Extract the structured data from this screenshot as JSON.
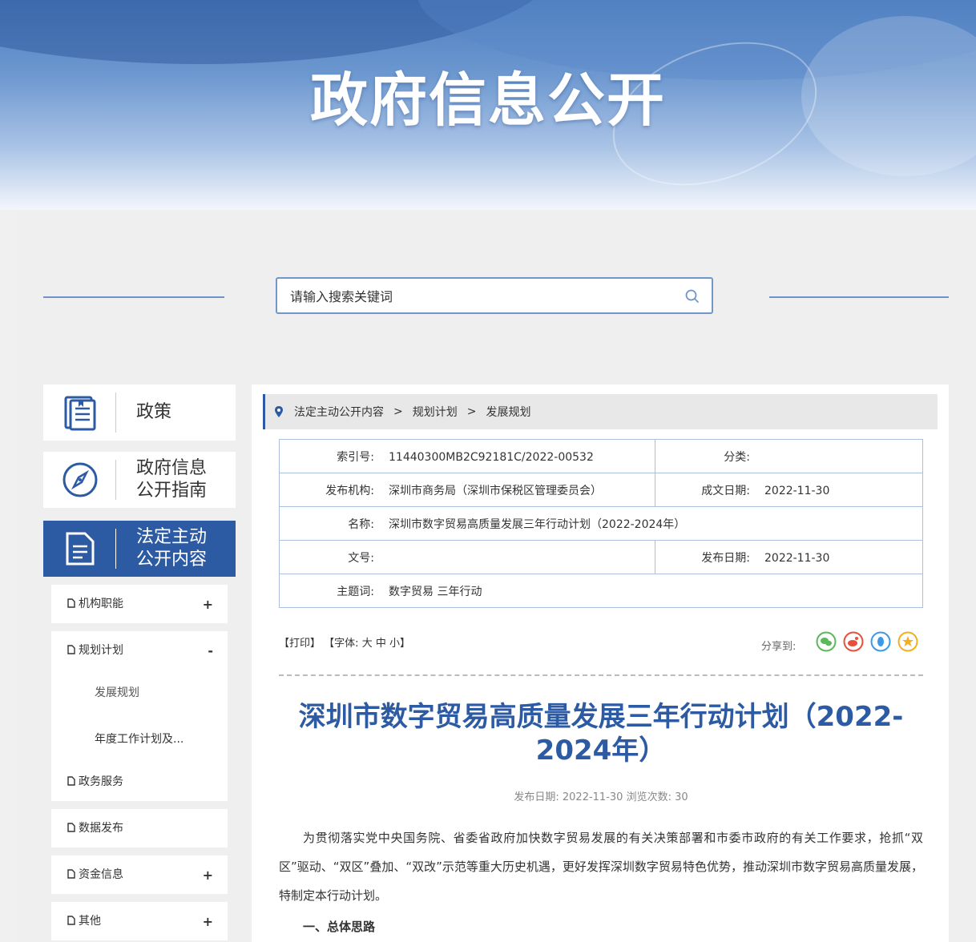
{
  "banner": {
    "title": "政府信息公开"
  },
  "search": {
    "placeholder": "请输入搜索关键词"
  },
  "nav": {
    "main": [
      {
        "label": "政策"
      },
      {
        "label": "政府信息\n公开指南"
      },
      {
        "label": "法定主动\n公开内容"
      }
    ],
    "sub": [
      {
        "label": "机构职能",
        "toggle": "+"
      },
      {
        "label": "规划计划",
        "toggle": "-",
        "children": [
          "发展规划",
          "年度工作计划及..."
        ]
      },
      {
        "label": "政务服务",
        "toggle": ""
      },
      {
        "label": "数据发布",
        "toggle": ""
      },
      {
        "label": "资金信息",
        "toggle": "+"
      },
      {
        "label": "其他",
        "toggle": "+"
      }
    ]
  },
  "breadcrumb": {
    "items": [
      "法定主动公开内容",
      "规划计划",
      "发展规划"
    ],
    "sep": ">"
  },
  "meta": {
    "index_label": "索引号:",
    "index_value": "11440300MB2C92181C/2022-00532",
    "category_label": "分类:",
    "category_value": "",
    "org_label": "发布机构:",
    "org_value": "深圳市商务局（深圳市保税区管理委员会）",
    "created_label": "成文日期:",
    "created_value": "2022-11-30",
    "name_label": "名称:",
    "name_value": "深圳市数字贸易高质量发展三年行动计划（2022-2024年）",
    "docno_label": "文号:",
    "docno_value": "",
    "published_label": "发布日期:",
    "published_value": "2022-11-30",
    "keywords_label": "主题词:",
    "keywords_value": "数字贸易 三年行动"
  },
  "tools": {
    "print": "【打印】",
    "font": "【字体:",
    "font_large": "大",
    "font_medium": "中",
    "font_small": "小】",
    "share_label": "分享到:"
  },
  "share_colors": {
    "wechat": "#5cb85c",
    "weibo": "#e8503a",
    "qq": "#3a9ae8",
    "qzone": "#f0b020"
  },
  "article": {
    "title": "深圳市数字贸易高质量发展三年行动计划（2022-2024年）",
    "meta_date_label": "发布日期:",
    "meta_date": "2022-11-30",
    "meta_views_label": "浏览次数:",
    "meta_views": "30",
    "body": "为贯彻落实党中央国务院、省委省政府加快数字贸易发展的有关决策部署和市委市政府的有关工作要求，抢抓“双区”驱动、“双区”叠加、“双改”示范等重大历史机遇，更好发挥深圳数字贸易特色优势，推动深圳市数字贸易高质量发展，特制定本行动计划。",
    "heading": "一、总体思路"
  }
}
